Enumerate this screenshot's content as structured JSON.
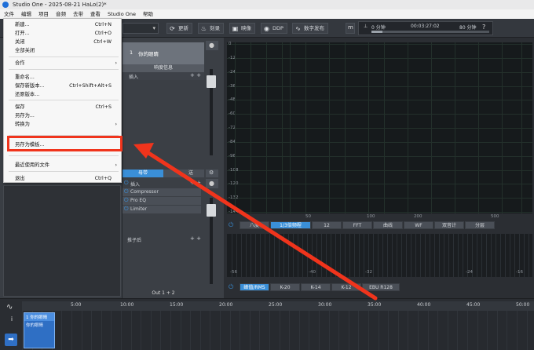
{
  "window": {
    "title": "Studio One - 2025-08-21 HaLo(2)*"
  },
  "menubar": [
    "文件",
    "编辑",
    "项目",
    "音频",
    "去带",
    "查看",
    "Studio One",
    "帮助"
  ],
  "toolbar": {
    "buttons": [
      {
        "icon": "refresh-icon",
        "label": "更新"
      },
      {
        "icon": "flame-icon",
        "label": "刻录"
      },
      {
        "icon": "film-icon",
        "label": "映像"
      },
      {
        "icon": "disc-icon",
        "label": "DDP"
      },
      {
        "icon": "waveform-icon",
        "label": "数字发布"
      }
    ],
    "transport": {
      "position_left": "0 分钟",
      "position_time": "00:03:27:02",
      "position_right": "80 分钟"
    },
    "help": "?"
  },
  "file_menu": {
    "items": [
      {
        "label": "新建...",
        "shortcut": "Ctrl+N"
      },
      {
        "label": "打开...",
        "shortcut": "Ctrl+O"
      },
      {
        "label": "关闭",
        "shortcut": "Ctrl+W"
      },
      {
        "label": "全部关闭",
        "shortcut": ""
      },
      {
        "label": "合作",
        "shortcut": "",
        "submenu": true
      },
      {
        "label": "重命名...",
        "shortcut": ""
      },
      {
        "label": "保存新版本...",
        "shortcut": "Ctrl+Shift+Alt+S"
      },
      {
        "label": "还原版本...",
        "shortcut": ""
      },
      {
        "label": "保存",
        "shortcut": "Ctrl+S"
      },
      {
        "label": "另存为...",
        "shortcut": ""
      },
      {
        "label": "转换为",
        "shortcut": "",
        "submenu": true
      },
      {
        "label": "另存为模板...",
        "shortcut": ""
      },
      {
        "label": "最近使用的文件",
        "shortcut": "",
        "submenu": true
      },
      {
        "label": "退出",
        "shortcut": "Ctrl+Q"
      }
    ]
  },
  "channel": {
    "number": "1",
    "name": "你的眼睛",
    "sub_label": "响度信息",
    "insert_label": "插入",
    "master_tab": "母带",
    "send_tab_partial": "送",
    "master_insert_label": "插入",
    "plugins": [
      "Compressor",
      "Pro EQ",
      "Limiter"
    ],
    "post_label": "推子后",
    "output": "Out 1 + 2"
  },
  "analyzer": {
    "y_ticks": [
      "0",
      "-12",
      "-24",
      "-36",
      "-48",
      "-60",
      "-72",
      "-84",
      "-96",
      "-108",
      "-120",
      "-132",
      "-144"
    ],
    "x_ticks": [
      "50",
      "100",
      "200",
      "500"
    ],
    "tabs_top": [
      "八度",
      "1/3倍频程",
      "12",
      "FFT",
      "曲线",
      "WF",
      "双音计",
      "分层"
    ],
    "active_top": "1/3倍频程",
    "meter_ticks": [
      "-56",
      "-40",
      "-32",
      "-24",
      "-16"
    ],
    "tabs_bottom": [
      "峰值/RMS",
      "K-20",
      "K-14",
      "K-12",
      "EBU R128"
    ],
    "active_bottom": "峰值/RMS"
  },
  "timeline": {
    "marks": [
      "5:00",
      "10:00",
      "15:00",
      "20:00",
      "25:00",
      "30:00",
      "35:00",
      "40:00",
      "45:00",
      "50:00"
    ],
    "clip_title": "1 你的眼睛",
    "clip_sub": "你的眼睛"
  },
  "colors": {
    "accent": "#3a8fd8",
    "highlight": "#f0341c",
    "plot_bg": "#161a1c"
  }
}
